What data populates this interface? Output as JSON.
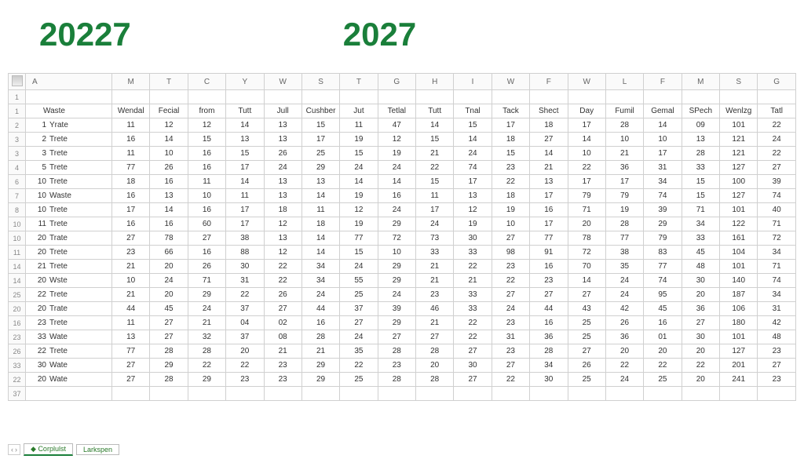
{
  "titles": {
    "left": "20227",
    "right": "2027"
  },
  "columns_letters": [
    "A",
    "M",
    "T",
    "C",
    "Y",
    "W",
    "S",
    "T",
    "G",
    "H",
    "I",
    "W",
    "F",
    "W",
    "L",
    "F",
    "M",
    "S",
    "G"
  ],
  "header_labels": [
    "Waste",
    "Wendal",
    "Fecial",
    "from",
    "Tutt",
    "Jull",
    "Cushber",
    "Jut",
    "Tetlal",
    "Tutt",
    "Tnal",
    "Tack",
    "Shect",
    "Day",
    "Fumil",
    "Gemal",
    "SPech",
    "Wenlzg",
    "Tatl"
  ],
  "row_numbers": [
    "1",
    "1",
    "2",
    "3",
    "3",
    "4",
    "6",
    "7",
    "8",
    "10",
    "10",
    "11",
    "14",
    "14",
    "25",
    "20",
    "16",
    "23",
    "26",
    "33",
    "22",
    "37"
  ],
  "rows": [
    {
      "idx": "1",
      "name": "Yrate",
      "v": [
        "11",
        "12",
        "12",
        "14",
        "13",
        "15",
        "11",
        "47",
        "14",
        "15",
        "17",
        "18",
        "17",
        "28",
        "14",
        "09",
        "101",
        "22"
      ]
    },
    {
      "idx": "2",
      "name": "Trete",
      "v": [
        "16",
        "14",
        "15",
        "13",
        "13",
        "17",
        "19",
        "12",
        "15",
        "14",
        "18",
        "27",
        "14",
        "10",
        "10",
        "13",
        "121",
        "24"
      ]
    },
    {
      "idx": "3",
      "name": "Trete",
      "v": [
        "11",
        "10",
        "16",
        "15",
        "26",
        "25",
        "15",
        "19",
        "21",
        "24",
        "15",
        "14",
        "10",
        "21",
        "17",
        "28",
        "121",
        "22"
      ]
    },
    {
      "idx": "5",
      "name": "Trete",
      "v": [
        "77",
        "26",
        "16",
        "17",
        "24",
        "29",
        "24",
        "24",
        "22",
        "74",
        "23",
        "21",
        "22",
        "36",
        "31",
        "33",
        "127",
        "27"
      ]
    },
    {
      "idx": "10",
      "name": "Trete",
      "v": [
        "18",
        "16",
        "11",
        "14",
        "13",
        "13",
        "14",
        "14",
        "15",
        "17",
        "22",
        "13",
        "17",
        "17",
        "34",
        "15",
        "100",
        "39"
      ]
    },
    {
      "idx": "10",
      "name": "Waste",
      "v": [
        "16",
        "13",
        "10",
        "11",
        "13",
        "14",
        "19",
        "16",
        "11",
        "13",
        "18",
        "17",
        "79",
        "79",
        "74",
        "15",
        "127",
        "74"
      ]
    },
    {
      "idx": "10",
      "name": "Trete",
      "v": [
        "17",
        "14",
        "16",
        "17",
        "18",
        "11",
        "12",
        "24",
        "17",
        "12",
        "19",
        "16",
        "71",
        "19",
        "39",
        "71",
        "101",
        "40"
      ]
    },
    {
      "idx": "11",
      "name": "Trete",
      "v": [
        "16",
        "16",
        "60",
        "17",
        "12",
        "18",
        "19",
        "29",
        "24",
        "19",
        "10",
        "17",
        "20",
        "28",
        "29",
        "34",
        "122",
        "71"
      ]
    },
    {
      "idx": "20",
      "name": "Trate",
      "v": [
        "27",
        "78",
        "27",
        "38",
        "13",
        "14",
        "77",
        "72",
        "73",
        "30",
        "27",
        "77",
        "78",
        "77",
        "79",
        "33",
        "161",
        "72"
      ]
    },
    {
      "idx": "20",
      "name": "Trete",
      "v": [
        "23",
        "66",
        "16",
        "88",
        "12",
        "14",
        "15",
        "10",
        "33",
        "33",
        "98",
        "91",
        "72",
        "38",
        "83",
        "45",
        "104",
        "34"
      ]
    },
    {
      "idx": "21",
      "name": "Trete",
      "v": [
        "21",
        "20",
        "26",
        "30",
        "22",
        "34",
        "24",
        "29",
        "21",
        "22",
        "23",
        "16",
        "70",
        "35",
        "77",
        "48",
        "101",
        "71"
      ]
    },
    {
      "idx": "20",
      "name": "Wste",
      "v": [
        "10",
        "24",
        "71",
        "31",
        "22",
        "34",
        "55",
        "29",
        "21",
        "21",
        "22",
        "23",
        "14",
        "24",
        "74",
        "30",
        "140",
        "74"
      ]
    },
    {
      "idx": "22",
      "name": "Trete",
      "v": [
        "21",
        "20",
        "29",
        "22",
        "26",
        "24",
        "25",
        "24",
        "23",
        "33",
        "27",
        "27",
        "27",
        "24",
        "95",
        "20",
        "187",
        "34"
      ]
    },
    {
      "idx": "20",
      "name": "Trate",
      "v": [
        "44",
        "45",
        "24",
        "37",
        "27",
        "44",
        "37",
        "39",
        "46",
        "33",
        "24",
        "44",
        "43",
        "42",
        "45",
        "36",
        "106",
        "31"
      ]
    },
    {
      "idx": "23",
      "name": "Trete",
      "v": [
        "11",
        "27",
        "21",
        "04",
        "02",
        "16",
        "27",
        "29",
        "21",
        "22",
        "23",
        "16",
        "25",
        "26",
        "16",
        "27",
        "180",
        "42"
      ]
    },
    {
      "idx": "33",
      "name": "Wate",
      "v": [
        "13",
        "27",
        "32",
        "37",
        "08",
        "28",
        "24",
        "27",
        "27",
        "22",
        "31",
        "36",
        "25",
        "36",
        "01",
        "30",
        "101",
        "48"
      ]
    },
    {
      "idx": "22",
      "name": "Trete",
      "v": [
        "77",
        "28",
        "28",
        "20",
        "21",
        "21",
        "35",
        "28",
        "28",
        "27",
        "23",
        "28",
        "27",
        "20",
        "20",
        "20",
        "127",
        "23"
      ]
    },
    {
      "idx": "30",
      "name": "Wate",
      "v": [
        "27",
        "29",
        "22",
        "22",
        "23",
        "29",
        "22",
        "23",
        "20",
        "30",
        "27",
        "34",
        "26",
        "22",
        "22",
        "22",
        "201",
        "27"
      ]
    },
    {
      "idx": "20",
      "name": "Wate",
      "v": [
        "27",
        "28",
        "29",
        "23",
        "23",
        "29",
        "25",
        "28",
        "28",
        "27",
        "22",
        "30",
        "25",
        "24",
        "25",
        "20",
        "241",
        "23"
      ]
    }
  ],
  "footer": {
    "nav_left": "‹",
    "nav_right": "›",
    "tab1_icon": "◆",
    "tab1": "Corplulst",
    "tab2": "Larkspen"
  }
}
